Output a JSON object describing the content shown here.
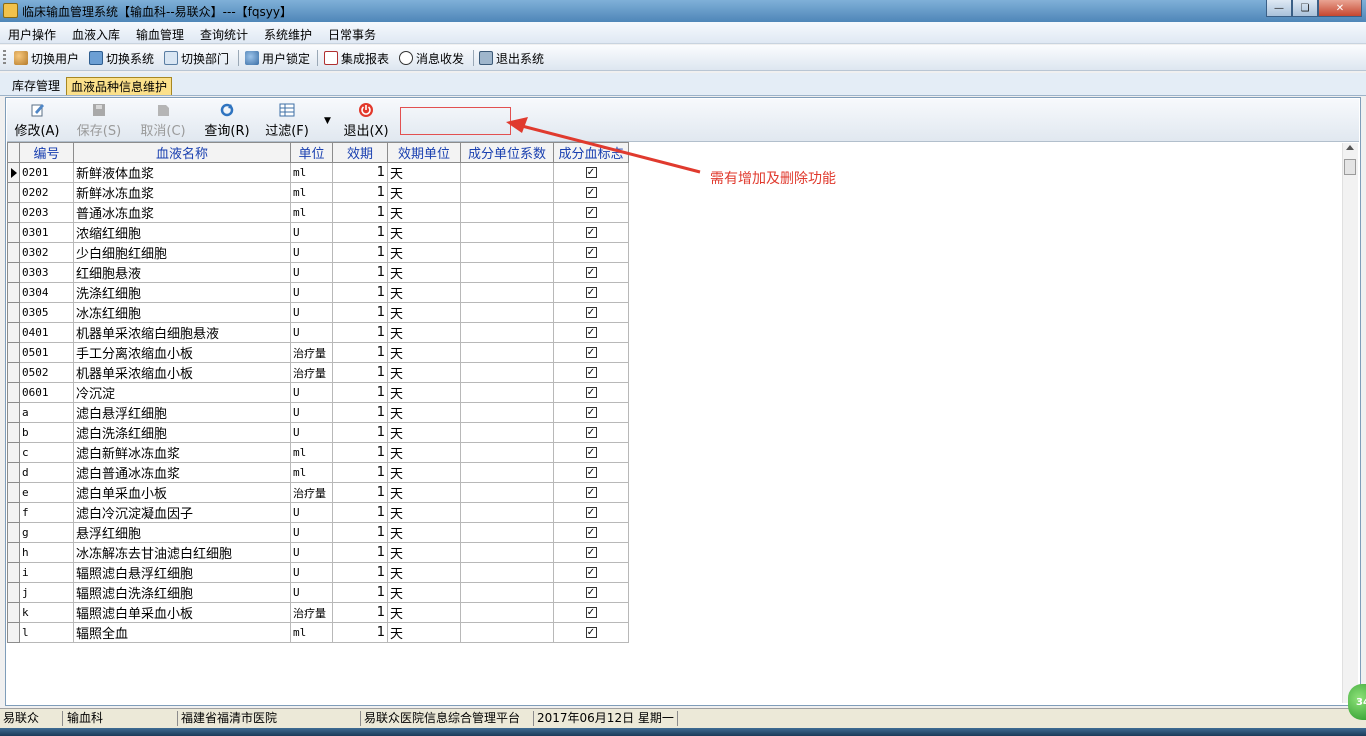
{
  "window": {
    "title": "临床输血管理系统【输血科--易联众】---【fqsyy】"
  },
  "menu": [
    "用户操作",
    "血液入库",
    "输血管理",
    "查询统计",
    "系统维护",
    "日常事务"
  ],
  "toolbar": {
    "switch_user": "切换用户",
    "switch_system": "切换系统",
    "switch_dept": "切换部门",
    "user_lock": "用户锁定",
    "report": "集成报表",
    "messages": "消息收发",
    "exit": "退出系统"
  },
  "tabs": [
    "库存管理",
    "血液品种信息维护"
  ],
  "actions": {
    "modify": "修改(A)",
    "save": "保存(S)",
    "cancel": "取消(C)",
    "query": "查询(R)",
    "filter": "过滤(F)",
    "exit": "退出(X)"
  },
  "annotation": "需有增加及删除功能",
  "grid": {
    "columns": [
      "编号",
      "血液名称",
      "单位",
      "效期",
      "效期单位",
      "成分单位系数",
      "成分血标志"
    ],
    "rows": [
      {
        "code": "0201",
        "name": "新鲜液体血浆",
        "unit": "ml",
        "expiry": "1",
        "expiry_unit": "天",
        "coef": "",
        "flag": true
      },
      {
        "code": "0202",
        "name": "新鲜冰冻血浆",
        "unit": "ml",
        "expiry": "1",
        "expiry_unit": "天",
        "coef": "",
        "flag": true
      },
      {
        "code": "0203",
        "name": "普通冰冻血浆",
        "unit": "ml",
        "expiry": "1",
        "expiry_unit": "天",
        "coef": "",
        "flag": true
      },
      {
        "code": "0301",
        "name": "浓缩红细胞",
        "unit": "U",
        "expiry": "1",
        "expiry_unit": "天",
        "coef": "",
        "flag": true
      },
      {
        "code": "0302",
        "name": "少白细胞红细胞",
        "unit": "U",
        "expiry": "1",
        "expiry_unit": "天",
        "coef": "",
        "flag": true
      },
      {
        "code": "0303",
        "name": "红细胞悬液",
        "unit": "U",
        "expiry": "1",
        "expiry_unit": "天",
        "coef": "",
        "flag": true
      },
      {
        "code": "0304",
        "name": "洗涤红细胞",
        "unit": "U",
        "expiry": "1",
        "expiry_unit": "天",
        "coef": "",
        "flag": true
      },
      {
        "code": "0305",
        "name": "冰冻红细胞",
        "unit": "U",
        "expiry": "1",
        "expiry_unit": "天",
        "coef": "",
        "flag": true
      },
      {
        "code": "0401",
        "name": "机器单采浓缩白细胞悬液",
        "unit": "U",
        "expiry": "1",
        "expiry_unit": "天",
        "coef": "",
        "flag": true
      },
      {
        "code": "0501",
        "name": "手工分离浓缩血小板",
        "unit": "治疗量",
        "expiry": "1",
        "expiry_unit": "天",
        "coef": "",
        "flag": true
      },
      {
        "code": "0502",
        "name": "机器单采浓缩血小板",
        "unit": "治疗量",
        "expiry": "1",
        "expiry_unit": "天",
        "coef": "",
        "flag": true
      },
      {
        "code": "0601",
        "name": "冷沉淀",
        "unit": "U",
        "expiry": "1",
        "expiry_unit": "天",
        "coef": "",
        "flag": true
      },
      {
        "code": "a",
        "name": "滤白悬浮红细胞",
        "unit": "U",
        "expiry": "1",
        "expiry_unit": "天",
        "coef": "",
        "flag": true
      },
      {
        "code": "b",
        "name": "滤白洗涤红细胞",
        "unit": "U",
        "expiry": "1",
        "expiry_unit": "天",
        "coef": "",
        "flag": true
      },
      {
        "code": "c",
        "name": "滤白新鲜冰冻血浆",
        "unit": "ml",
        "expiry": "1",
        "expiry_unit": "天",
        "coef": "",
        "flag": true
      },
      {
        "code": "d",
        "name": "滤白普通冰冻血浆",
        "unit": "ml",
        "expiry": "1",
        "expiry_unit": "天",
        "coef": "",
        "flag": true
      },
      {
        "code": "e",
        "name": "滤白单采血小板",
        "unit": "治疗量",
        "expiry": "1",
        "expiry_unit": "天",
        "coef": "",
        "flag": true
      },
      {
        "code": "f",
        "name": "滤白冷沉淀凝血因子",
        "unit": "U",
        "expiry": "1",
        "expiry_unit": "天",
        "coef": "",
        "flag": true
      },
      {
        "code": "g",
        "name": "悬浮红细胞",
        "unit": "U",
        "expiry": "1",
        "expiry_unit": "天",
        "coef": "",
        "flag": true
      },
      {
        "code": "h",
        "name": "冰冻解冻去甘油滤白红细胞",
        "unit": "U",
        "expiry": "1",
        "expiry_unit": "天",
        "coef": "",
        "flag": true
      },
      {
        "code": "i",
        "name": "辐照滤白悬浮红细胞",
        "unit": "U",
        "expiry": "1",
        "expiry_unit": "天",
        "coef": "",
        "flag": true
      },
      {
        "code": "j",
        "name": "辐照滤白洗涤红细胞",
        "unit": "U",
        "expiry": "1",
        "expiry_unit": "天",
        "coef": "",
        "flag": true
      },
      {
        "code": "k",
        "name": "辐照滤白单采血小板",
        "unit": "治疗量",
        "expiry": "1",
        "expiry_unit": "天",
        "coef": "",
        "flag": true
      },
      {
        "code": "l",
        "name": "辐照全血",
        "unit": "ml",
        "expiry": "1",
        "expiry_unit": "天",
        "coef": "",
        "flag": true
      }
    ]
  },
  "status": [
    "易联众",
    "输血科",
    "福建省福清市医院",
    "易联众医院信息综合管理平台",
    "2017年06月12日 星期一"
  ],
  "badge": "34",
  "colors": {
    "annotation": "#e03a2e",
    "header_text": "#1a40b0",
    "active_tab": "#fbe08a"
  }
}
